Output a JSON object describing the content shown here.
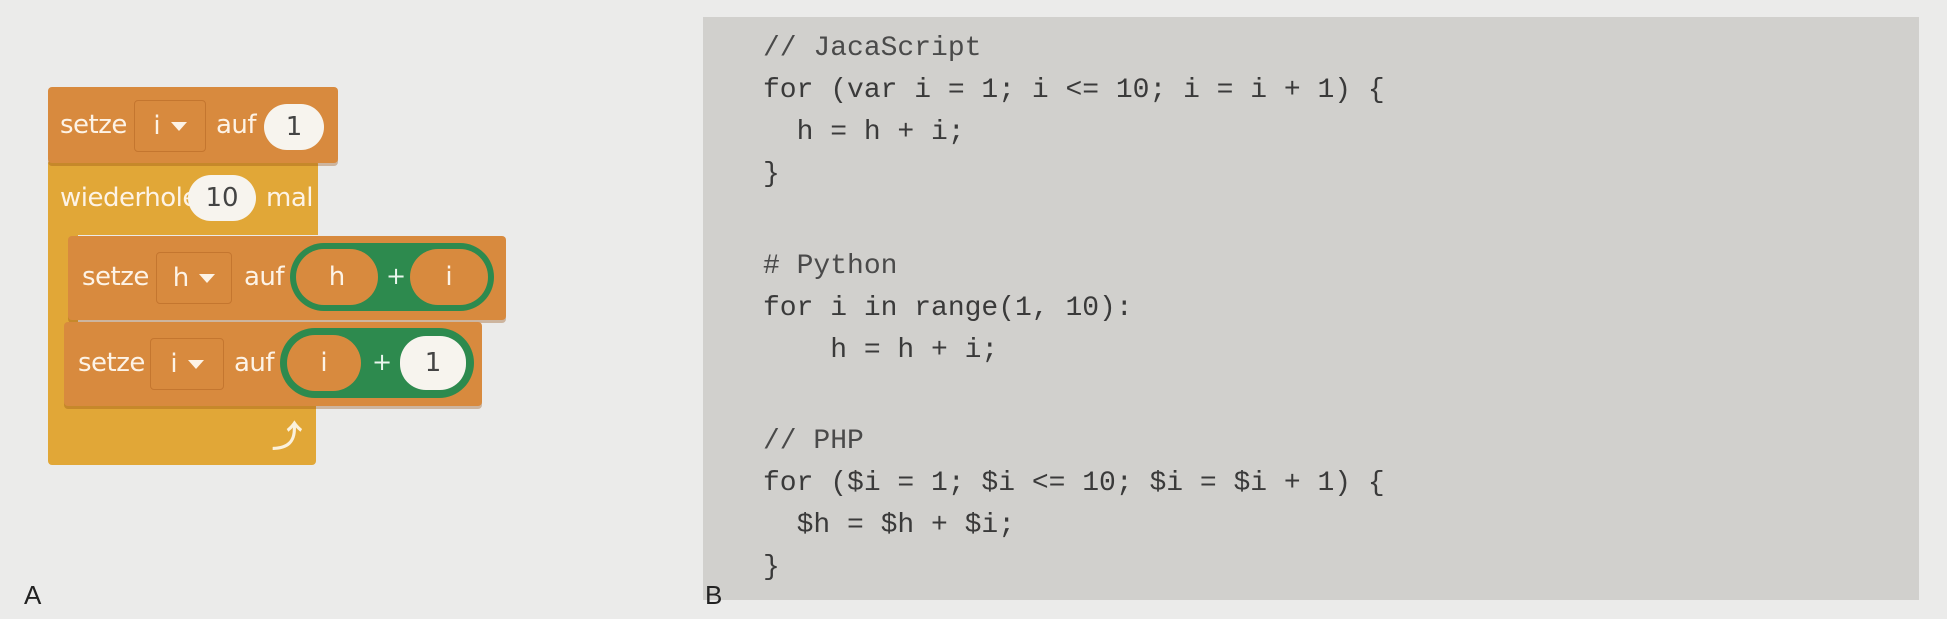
{
  "panel_a": {
    "label": "A",
    "set_i": {
      "keyword": "setze",
      "variable": "i",
      "to": "auf",
      "value": "1"
    },
    "repeat": {
      "keyword": "wiederhole",
      "count": "10",
      "suffix": "mal"
    },
    "set_h": {
      "keyword": "setze",
      "variable": "h",
      "to": "auf",
      "left": "h",
      "op": "+",
      "right": "i"
    },
    "inc_i": {
      "keyword": "setze",
      "variable": "i",
      "to": "auf",
      "left": "i",
      "op": "+",
      "right": "1"
    },
    "loop_icon": "rotate-arrow-icon",
    "colors": {
      "orange": "#d88a3e",
      "yellow": "#e1a737",
      "green": "#2d8a4e"
    }
  },
  "panel_b": {
    "label": "B",
    "javascript": [
      "// JacaScript",
      "for (var i = 1; i <= 10; i = i + 1) {",
      "  h = h + i;",
      "}"
    ],
    "python": [
      "# Python",
      "for i in range(1, 10):",
      "    h = h + i;"
    ],
    "php": [
      "// PHP",
      "for ($i = 1; $i <= 10; $i = $i + 1) {",
      "  $h = $h + $i;",
      "}"
    ]
  }
}
